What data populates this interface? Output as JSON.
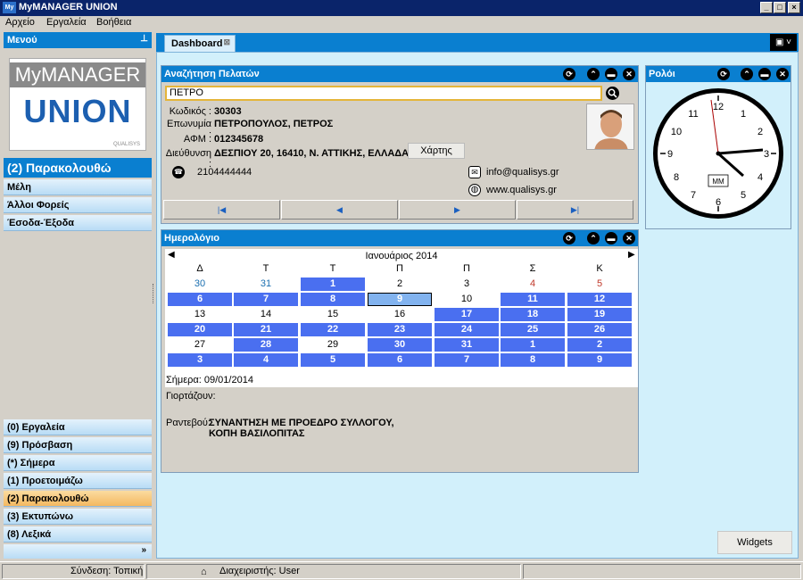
{
  "window": {
    "title": "MyMANAGER UNION",
    "icon_text": "My",
    "minimize": "_",
    "maximize": "□",
    "close": "×"
  },
  "menubar": {
    "items": [
      "Αρχείο",
      "Εργαλεία",
      "Βοήθεια"
    ]
  },
  "sidebar": {
    "header": "Μενού",
    "pin": "⊥",
    "logo": {
      "top": "MyMANAGER",
      "main": "UNION",
      "brand": "QUALISYS"
    },
    "section_title": "(2) Παρακολουθώ",
    "items": [
      "Μέλη",
      "Άλλοι Φορείς",
      "Έσοδα-Έξοδα"
    ],
    "bottom_items": [
      "(0) Εργαλεία",
      "(9) Πρόσβαση",
      "(*) Σήμερα",
      "(1) Προετοιμάζω",
      "(2) Παρακολουθώ",
      "(3) Εκτυπώνω",
      "(8) Λεξικά"
    ],
    "active_bottom": 4,
    "more": "»"
  },
  "tabs": {
    "main": "Dashboard",
    "close": "⊠",
    "menu": "▣ ˅"
  },
  "customer_panel": {
    "title": "Αναζήτηση Πελατών",
    "search_value": "ΠΕΤΡΟ",
    "fields": {
      "code_label": "Κωδικός :",
      "code": "30303",
      "name_label": "Επωνυμία :",
      "name": "ΠΕΤΡΟΠΟΥΛΟΣ, ΠΕΤΡΟΣ",
      "afm_label": "ΑΦΜ :",
      "afm": "012345678",
      "address_label": "Διεύθυνση :",
      "address": "ΔΕΣΠΙΟΥ 20, 16410, Ν. ΑΤΤΙΚΗΣ, ΕΛΛΑΔΑ"
    },
    "map_button": "Χάρτης",
    "phone": "2104444444",
    "email": "info@qualisys.gr",
    "website": "www.qualisys.gr",
    "nav": [
      "|◀",
      "◀",
      "▶",
      "▶|"
    ]
  },
  "calendar_panel": {
    "title": "Ημερολόγιο",
    "month": "Ιανουάριος 2014",
    "days_of_week": [
      "Δ",
      "Τ",
      "Τ",
      "Π",
      "Π",
      "Σ",
      "Κ"
    ],
    "weeks": [
      [
        "30",
        "31",
        "1",
        "2",
        "3",
        "4",
        "5"
      ],
      [
        "6",
        "7",
        "8",
        "9",
        "10",
        "11",
        "12"
      ],
      [
        "13",
        "14",
        "15",
        "16",
        "17",
        "18",
        "19"
      ],
      [
        "20",
        "21",
        "22",
        "23",
        "24",
        "25",
        "26"
      ],
      [
        "27",
        "28",
        "29",
        "30",
        "31",
        "1",
        "2"
      ],
      [
        "3",
        "4",
        "5",
        "6",
        "7",
        "8",
        "9"
      ]
    ],
    "styles": [
      [
        "prev",
        "prev",
        "b",
        "",
        "",
        "red",
        "red"
      ],
      [
        "b",
        "b",
        "b",
        "sel",
        "",
        "b",
        "b"
      ],
      [
        "",
        "",
        "",
        "",
        "b",
        "b",
        "b"
      ],
      [
        "b",
        "b",
        "b",
        "b",
        "b",
        "b",
        "b"
      ],
      [
        "",
        "b",
        "",
        "b",
        "b",
        "b",
        "b"
      ],
      [
        "b",
        "b",
        "b",
        "b",
        "b",
        "b",
        "b"
      ]
    ],
    "today": "Σήμερα: 09/01/2014",
    "celebrating_label": "Γιορτάζουν:",
    "appointment_label": "Ραντεβού:",
    "appointment_line1": "ΣΥΝΑΝΤΗΣΗ ΜΕ ΠΡΟΕΔΡΟ ΣΥΛΛΟΓΟΥ,",
    "appointment_line2": "ΚΟΠΗ ΒΑΣΙΛΟΠΙΤΑΣ"
  },
  "clock_panel": {
    "title": "Ρολόι",
    "badge": "MM"
  },
  "panel_buttons": {
    "refresh": "⟳",
    "collapse": "⌃",
    "minimize": "▬",
    "close": "✕"
  },
  "widgets_button": "Widgets",
  "statusbar": {
    "connection": "Σύνδεση: Τοπική",
    "admin": "Διαχειριστής: User"
  }
}
